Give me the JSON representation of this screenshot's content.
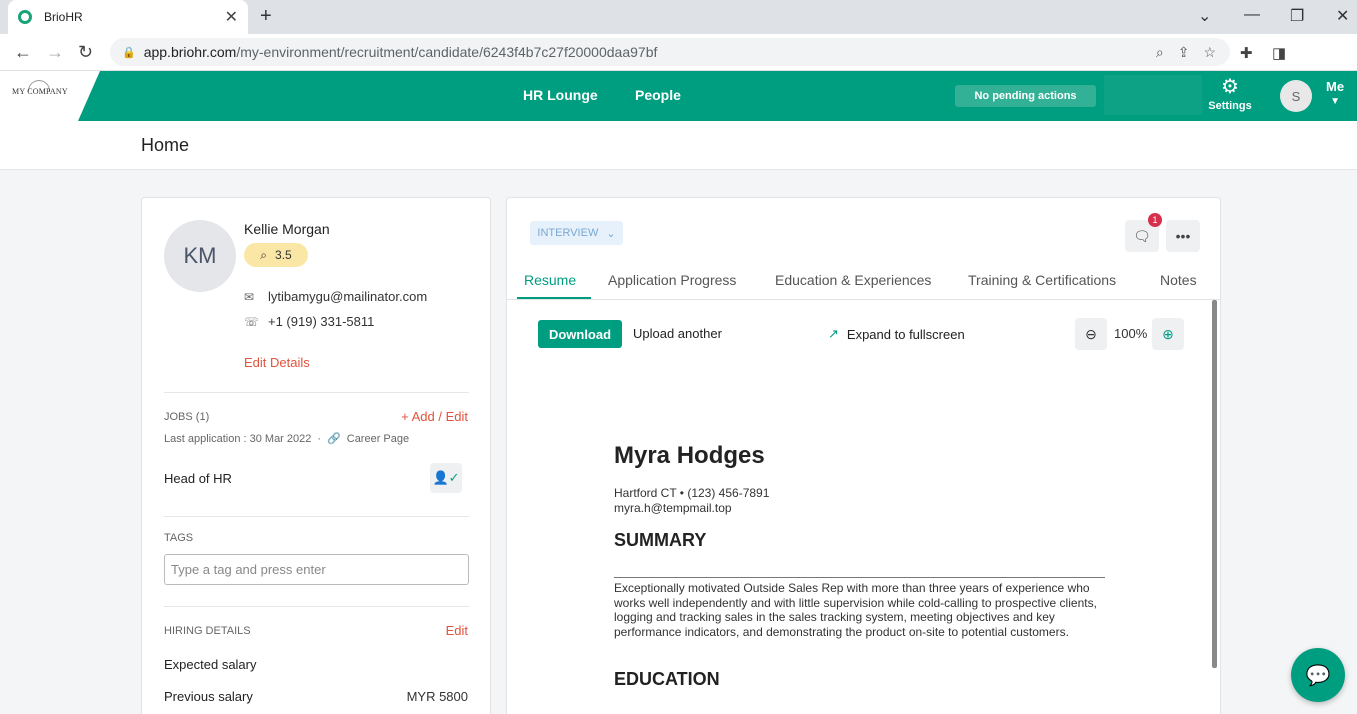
{
  "browser": {
    "tab_title": "BrioHR",
    "url_host": "app.briohr.com",
    "url_path": "/my-environment/recruitment/candidate/6243f4b7c27f20000daa97bf"
  },
  "header": {
    "logo_text": "MY COMPANY",
    "nav": [
      "HR Lounge",
      "People"
    ],
    "pending_label": "No pending actions",
    "settings_label": "Settings",
    "avatar_initial": "S",
    "me_label": "Me"
  },
  "page": {
    "title": "Home"
  },
  "candidate": {
    "initials": "KM",
    "name": "Kellie Morgan",
    "rating": "3.5",
    "email": "lytibamygu@mailinator.com",
    "phone": "+1 (919) 331-5811",
    "edit_details": "Edit Details",
    "jobs_label": "JOBS (1)",
    "jobs_action": "+ Add / Edit",
    "last_application": "Last application : 30 Mar 2022",
    "source": "Career Page",
    "job_title": "Head of HR",
    "tags_label": "TAGS",
    "tags_placeholder": "Type a tag and press enter",
    "hiring_label": "HIRING DETAILS",
    "hiring_action": "Edit",
    "expected_salary_label": "Expected salary",
    "previous_salary_label": "Previous salary",
    "previous_salary_value": "MYR 5800"
  },
  "detail": {
    "status": "INTERVIEW",
    "comment_count": "1",
    "tabs": [
      "Resume",
      "Application Progress",
      "Education & Experiences",
      "Training & Certifications",
      "Notes"
    ],
    "download_label": "Download",
    "upload_label": "Upload another",
    "expand_label": "Expand to fullscreen",
    "zoom": "100%"
  },
  "resume": {
    "name": "Myra Hodges",
    "location_phone": "Hartford CT • (123) 456-7891",
    "email": "myra.h@tempmail.top",
    "summary_heading": "SUMMARY",
    "summary_text": "Exceptionally motivated Outside Sales Rep with more than three years of experience who works well independently and with little supervision while cold-calling to prospective clients, logging and tracking sales in the sales tracking system, meeting objectives and key performance indicators, and demonstrating the product on-site to potential customers.",
    "education_heading": "EDUCATION"
  }
}
